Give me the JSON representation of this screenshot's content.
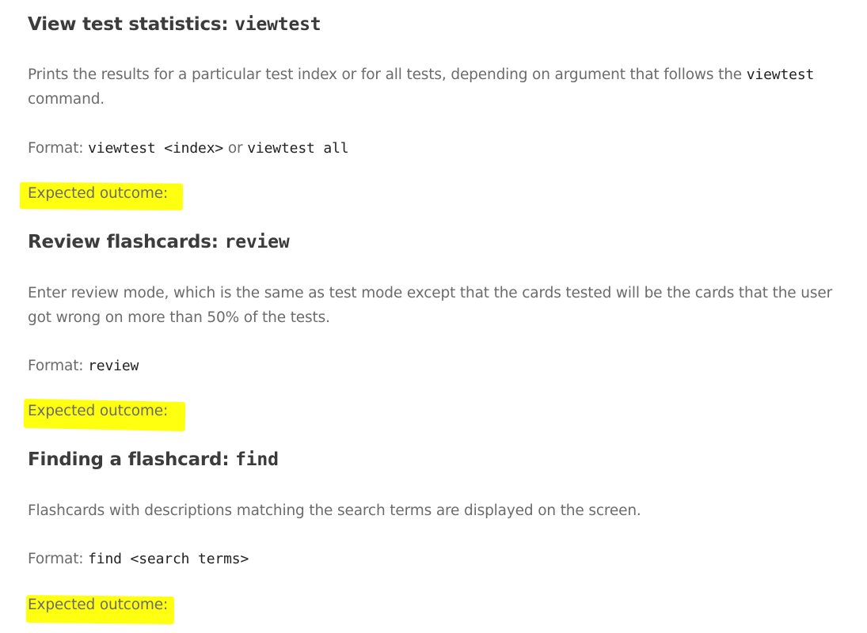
{
  "sections": [
    {
      "title": "View test statistics: ",
      "title_code": "viewtest",
      "desc_pre": "Prints the results for a particular test index or for all tests, depending on argument that follows the ",
      "desc_code": "viewtest",
      "desc_post": " command.",
      "format_label": "Format: ",
      "format_code_1": "viewtest <index>",
      "format_or": " or ",
      "format_code_2": "viewtest all",
      "outcome": "Expected outcome:"
    },
    {
      "title": "Review flashcards: ",
      "title_code": "review",
      "desc": "Enter review mode, which is the same as test mode except that the cards tested will be the cards that the user got wrong on more than 50% of the tests.",
      "format_label": "Format: ",
      "format_code": "review",
      "outcome": "Expected outcome:"
    },
    {
      "title": "Finding a flashcard: ",
      "title_code": "find",
      "desc": "Flashcards with descriptions matching the search terms are displayed on the screen.",
      "format_label": "Format: ",
      "format_code": "find <search terms>",
      "outcome": "Expected outcome:"
    }
  ],
  "colors": {
    "highlight": "#ffff10",
    "heading": "#3c3c3c",
    "body_text": "#6b6b6b",
    "code_text": "#222222"
  }
}
